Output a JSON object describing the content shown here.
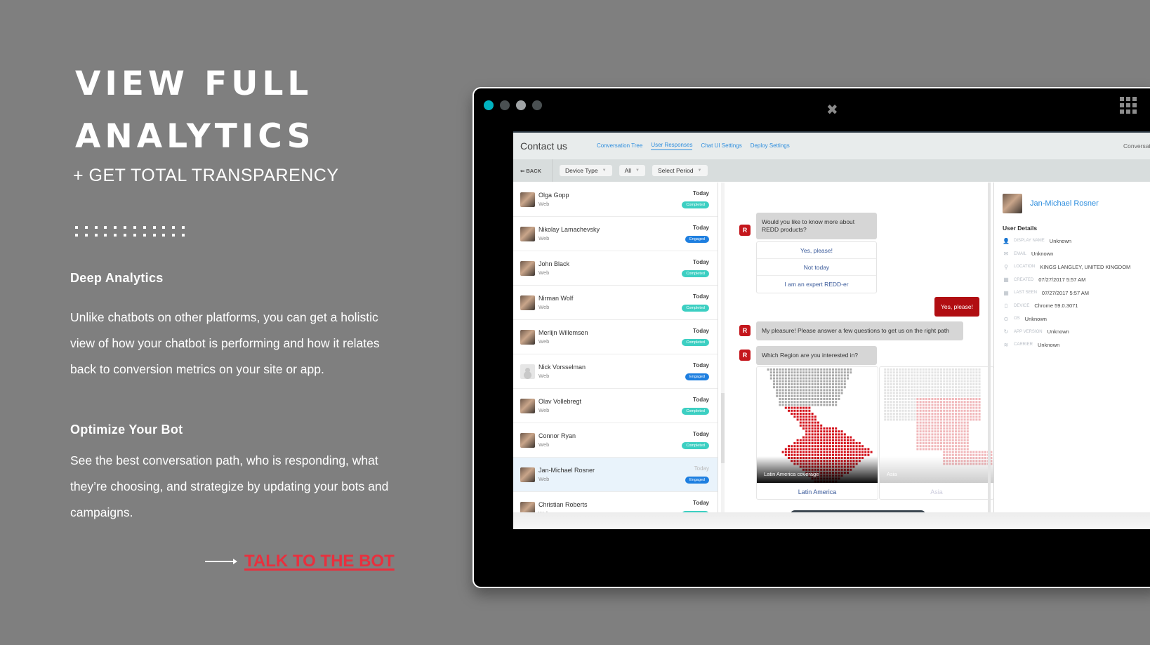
{
  "hero": {
    "title_line1": "VIEW FULL",
    "title_line2": "ANALYTICS",
    "subtitle": "+ GET TOTAL TRANSPARENCY"
  },
  "sections": [
    {
      "heading": "Deep Analytics",
      "body": "Unlike chatbots on other platforms, you can get a holistic view of how your chatbot is performing and how it relates back to conversion metrics on your site or app."
    },
    {
      "heading": "Optimize Your Bot",
      "body": "See the best conversation path, who is responding, what they’re choosing, and strategize by updating your bots and campaigns."
    }
  ],
  "cta": {
    "label": "TALK TO THE BOT",
    "color": "#e8303e"
  },
  "window": {
    "traffic_lights": [
      "#00b2bf",
      "#4a5052",
      "#a0a4a6",
      "#4a5052"
    ],
    "close_icon": "close-icon",
    "menu_icon": "grid-icon"
  },
  "app": {
    "title": "Contact us",
    "tabs": [
      {
        "label": "Conversation Tree",
        "active": false
      },
      {
        "label": "User Responses",
        "active": true
      },
      {
        "label": "Chat UI Settings",
        "active": false
      },
      {
        "label": "Deploy Settings",
        "active": false
      }
    ],
    "conversation_id_label": "Conversation ID",
    "back_label": "⇐ BACK",
    "filters": [
      {
        "label": "Device Type"
      },
      {
        "label": "All"
      },
      {
        "label": "Select Period"
      }
    ]
  },
  "status_colors": {
    "Completed": "#3ccfc2",
    "Engaged": "#1e7fe0"
  },
  "conversations": [
    {
      "name": "Olga Gopp",
      "channel": "Web",
      "date": "Today",
      "status": "Completed"
    },
    {
      "name": "Nikolay Lamachevsky",
      "channel": "Web",
      "date": "Today",
      "status": "Engaged"
    },
    {
      "name": "John Black",
      "channel": "Web",
      "date": "Today",
      "status": "Completed"
    },
    {
      "name": "Nirman Wolf",
      "channel": "Web",
      "date": "Today",
      "status": "Completed"
    },
    {
      "name": "Merlijn Willemsen",
      "channel": "Web",
      "date": "Today",
      "status": "Completed"
    },
    {
      "name": "Nick Vorsselman",
      "channel": "Web",
      "date": "Today",
      "status": "Engaged"
    },
    {
      "name": "Olav Vollebregt",
      "channel": "Web",
      "date": "Today",
      "status": "Completed"
    },
    {
      "name": "Connor Ryan",
      "channel": "Web",
      "date": "Today",
      "status": "Completed"
    },
    {
      "name": "Jan-Michael Rosner",
      "channel": "Web",
      "date": "Today",
      "status": "Engaged",
      "selected": true
    },
    {
      "name": "Christian Roberts",
      "channel": "Web",
      "date": "Today",
      "status": "Completed"
    }
  ],
  "chat": {
    "bot_avatar_letter": "R",
    "q1": "Would you like to know more about REDD products?",
    "q1_options": [
      "Yes, please!",
      "Not today",
      "I am an expert REDD-er"
    ],
    "user_reply": "Yes, please!",
    "m2": "My pleasure! Please answer a few questions to get us on the right path",
    "q3": "Which Region are you interested in?",
    "cards": [
      {
        "caption": "Latin America coverage",
        "label": "Latin America"
      },
      {
        "caption": "Asia",
        "label": "Asia"
      }
    ]
  },
  "user_details": {
    "name": "Jan-Michael Rosner",
    "heading": "User Details",
    "fields": [
      {
        "icon": "person-icon",
        "glyph": "👤",
        "key": "Display Name",
        "value": "Unknown"
      },
      {
        "icon": "email-icon",
        "glyph": "✉",
        "key": "Email",
        "value": "Unknown"
      },
      {
        "icon": "location-icon",
        "glyph": "⚲",
        "key": "Location",
        "value": "KINGS LANGLEY, UNITED KINGDOM"
      },
      {
        "icon": "calendar-icon",
        "glyph": "▦",
        "key": "Created",
        "value": "07/27/2017 5:57 AM"
      },
      {
        "icon": "calendar-icon",
        "glyph": "▦",
        "key": "Last Seen",
        "value": "07/27/2017 5:57 AM"
      },
      {
        "icon": "device-icon",
        "glyph": "▯",
        "key": "Device",
        "value": "Chrome 59.0.3071"
      },
      {
        "icon": "os-icon",
        "glyph": "⊙",
        "key": "OS",
        "value": "Unknown"
      },
      {
        "icon": "app-version-icon",
        "glyph": "↻",
        "key": "App Version",
        "value": "Unknown"
      },
      {
        "icon": "wifi-icon",
        "glyph": "≋",
        "key": "Carrier",
        "value": "Unknown"
      }
    ]
  }
}
